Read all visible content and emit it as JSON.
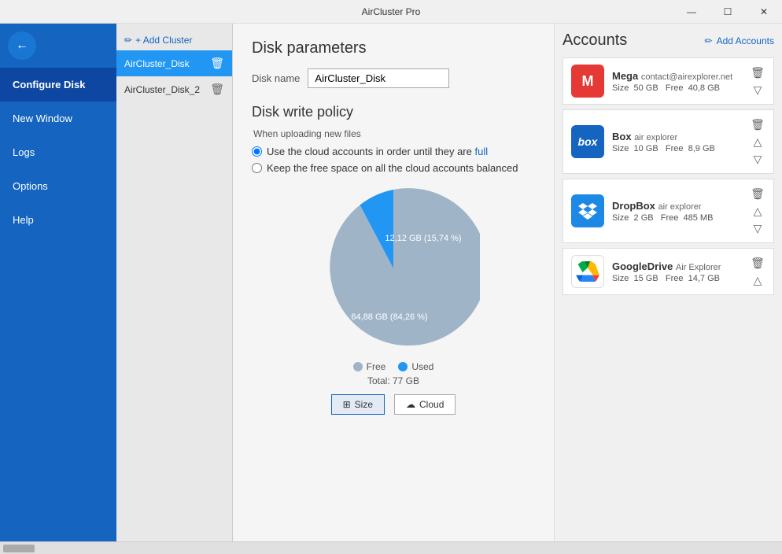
{
  "window": {
    "title": "AirCluster Pro",
    "controls": {
      "minimize": "—",
      "maximize": "☐",
      "close": "✕"
    }
  },
  "sidebar": {
    "back_icon": "←",
    "items": [
      {
        "label": "Configure Disk",
        "active": true
      },
      {
        "label": "New Window",
        "active": false
      },
      {
        "label": "Logs",
        "active": false
      },
      {
        "label": "Options",
        "active": false
      },
      {
        "label": "Help",
        "active": false
      }
    ]
  },
  "disk_panel": {
    "add_cluster_label": "+ Add Cluster",
    "disks": [
      {
        "name": "AirCluster_Disk",
        "active": true
      },
      {
        "name": "AirCluster_Disk_2",
        "active": false
      }
    ]
  },
  "main": {
    "disk_params_title": "Disk parameters",
    "disk_name_label": "Disk name",
    "disk_name_value": "AirCluster_Disk",
    "write_policy_title": "Disk write policy",
    "when_uploading_label": "When uploading new files",
    "radio_option1": "Use the cloud accounts in order until they are full",
    "radio_option2": "Keep the free space on all the cloud accounts balanced",
    "chart": {
      "used_label": "12,12 GB (15,74 %)",
      "free_label": "64,88 GB (84,26 %)",
      "legend_free": "Free",
      "legend_used": "Used",
      "total": "Total: 77 GB",
      "free_color": "#a0aec0",
      "used_color": "#2196f3",
      "free_percent": 84.26,
      "used_percent": 15.74
    },
    "btn_size_label": "Size",
    "btn_cloud_label": "Cloud"
  },
  "accounts": {
    "title": "Accounts",
    "add_accounts_label": "Add Accounts",
    "items": [
      {
        "name": "Mega",
        "email": "contact@airexplorer.net",
        "size": "50 GB",
        "free": "40,8 GB",
        "color": "#e53935",
        "logo_text": "M",
        "logo_bg": "#e53935"
      },
      {
        "name": "Box",
        "email": "air explorer",
        "size": "10 GB",
        "free": "8,9 GB",
        "color": "#1565c0",
        "logo_text": "box",
        "logo_bg": "#1565c0"
      },
      {
        "name": "DropBox",
        "email": "air explorer",
        "size": "2 GB",
        "free": "485 MB",
        "color": "#1e88e5",
        "logo_text": "❑",
        "logo_bg": "#1e88e5"
      },
      {
        "name": "GoogleDrive",
        "email": "Air Explorer",
        "size": "15 GB",
        "free": "14,7 GB",
        "color": "#43a047",
        "logo_text": "▲",
        "logo_bg": "#ffffff"
      }
    ]
  }
}
